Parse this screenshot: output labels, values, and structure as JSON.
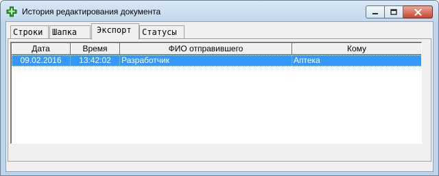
{
  "window": {
    "title": "История редактирования документа",
    "icon": "green-cross-icon",
    "controls": [
      "minimize",
      "maximize",
      "close"
    ]
  },
  "tabs": [
    {
      "label": "Строки",
      "active": false
    },
    {
      "label": "Шапка",
      "active": false
    },
    {
      "label": "Экспорт",
      "active": true
    },
    {
      "label": "Статусы",
      "active": false
    }
  ],
  "table": {
    "columns": [
      "Дата",
      "Время",
      "ФИО отправившего",
      "Кому"
    ],
    "rows": [
      {
        "date": "09.02.2016",
        "time": "13:42:02",
        "sender": "Разработчик",
        "recipient": "Аптека",
        "selected": true
      }
    ]
  },
  "colors": {
    "selection": "#3399ff",
    "titlebar": "#c8dcef",
    "icon_green": "#2e9e2e"
  }
}
